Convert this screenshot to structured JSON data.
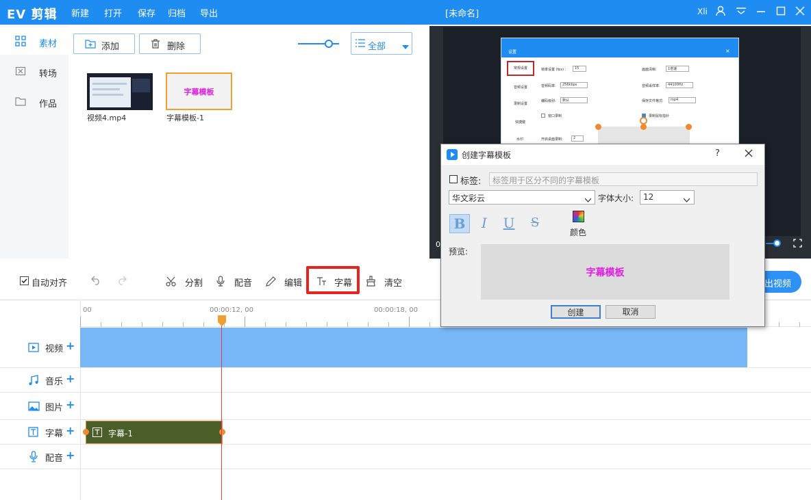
{
  "app": {
    "logo": "EV 剪辑",
    "window_title": "[未命名]",
    "user": "Xli"
  },
  "menu": [
    "新建",
    "打开",
    "保存",
    "归档",
    "导出"
  ],
  "nav": {
    "items": [
      {
        "label": "素材",
        "icon": "grid-icon",
        "active": true
      },
      {
        "label": "转场",
        "icon": "transition-icon",
        "active": false
      },
      {
        "label": "作品",
        "icon": "folder-icon",
        "active": false
      }
    ]
  },
  "media_toolbar": {
    "add_label": "添加",
    "delete_label": "删除",
    "filter_value": "全部"
  },
  "media": [
    {
      "label": "视频4.mp4",
      "type": "video"
    },
    {
      "label": "字幕模板-1",
      "type": "subtitle",
      "thumb_text": "字幕模板"
    }
  ],
  "edit_toolbar": {
    "auto_align": "自动对齐",
    "auto_align_checked": true,
    "split": "分割",
    "dub": "配音",
    "edit": "编辑",
    "subtitle": "字幕",
    "clear": "清空",
    "export": "出视频"
  },
  "timeline": {
    "ruler": [
      "00",
      "00:00:12, 00",
      "00:00:18, 00"
    ],
    "tracks": [
      {
        "label": "视频",
        "icon": "video-track-icon"
      },
      {
        "label": "音乐",
        "icon": "music-track-icon"
      },
      {
        "label": "图片",
        "icon": "image-track-icon"
      },
      {
        "label": "字幕",
        "icon": "subtitle-track-icon"
      },
      {
        "label": "配音",
        "icon": "mic-track-icon"
      }
    ],
    "subtitle_clip": "字幕-1"
  },
  "preview_settings": {
    "title": "设置",
    "tabs": [
      "常规设置",
      "音频设置",
      "录制设置",
      "快捷键",
      "水印"
    ],
    "fields": [
      "帧率设置 (fps) :",
      "音频码率:",
      "编码级别:",
      "画面清晰:",
      "音频采样率:",
      "保存文件格式:",
      "开启桌面录制:"
    ],
    "values": [
      "15",
      "256kbps",
      "默认",
      "1倍速",
      "44100Hz",
      "mp4",
      "2"
    ],
    "checks": [
      "窗口录制",
      "录制鼠标指针"
    ]
  },
  "dialog": {
    "title": "创建字幕模板",
    "help": "?",
    "tag_label": "标签:",
    "tag_placeholder": "标签用于区分不同的字幕模板",
    "font_value": "华文彩云",
    "size_label": "字体大小:",
    "size_value": "12",
    "format": {
      "bold": "B",
      "italic": "I",
      "underline": "U",
      "strike": "S"
    },
    "color_label": "颜色",
    "preview_label": "预览:",
    "preview_text": "字幕模板",
    "create": "创建",
    "cancel": "取消"
  },
  "colors": {
    "accent": "#1e8cf0",
    "clip_video": "#78b8f8",
    "clip_subtitle": "#4a5e28",
    "playhead": "#f09030",
    "highlight": "#e8221d",
    "preview_text": "#e020e0"
  }
}
